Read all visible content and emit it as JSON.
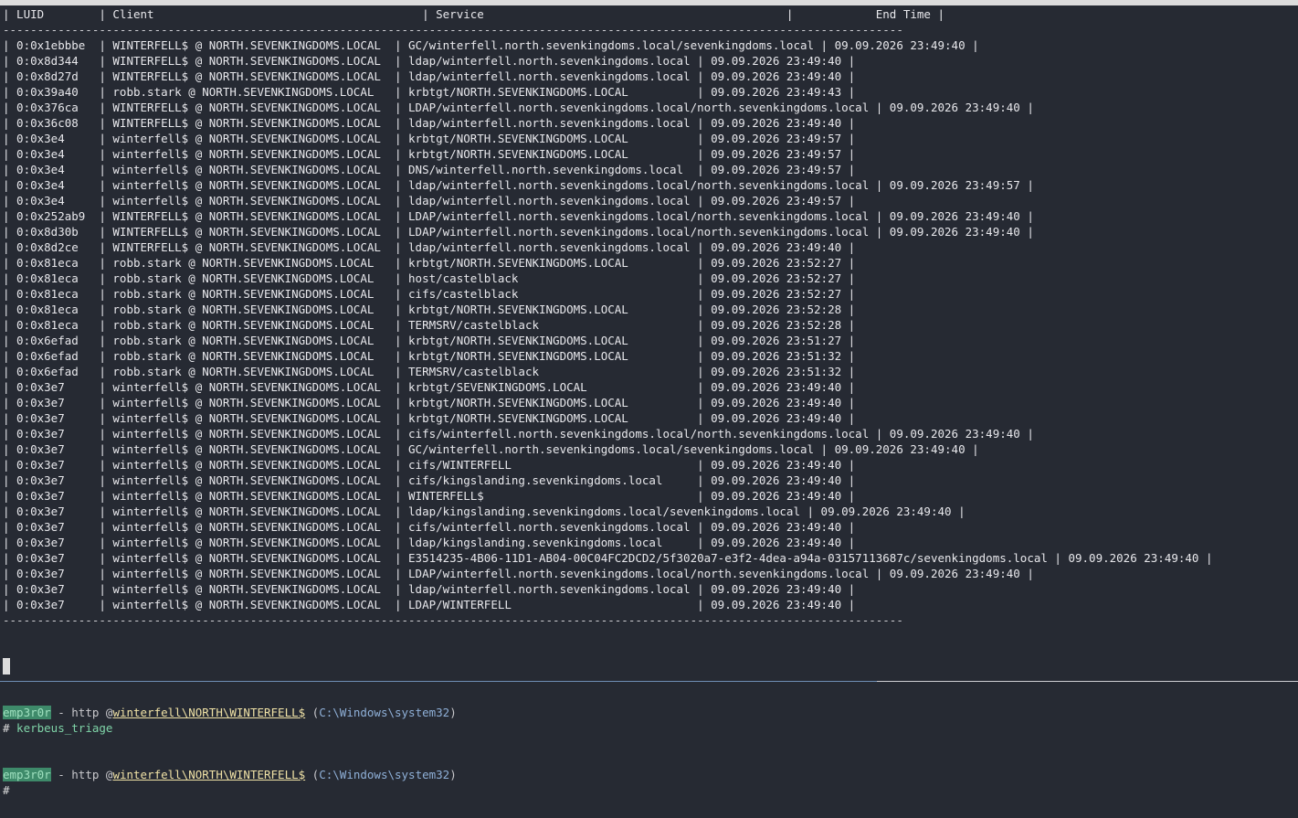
{
  "table": {
    "header": "| LUID        | Client                                       | Service                                            |            End Time |",
    "separator": "-----------------------------------------------------------------------------------------------------------------------------------",
    "rows": [
      "| 0:0x1ebbbe  | WINTERFELL$ @ NORTH.SEVENKINGDOMS.LOCAL  | GC/winterfell.north.sevenkingdoms.local/sevenkingdoms.local | 09.09.2026 23:49:40 |",
      "| 0:0x8d344   | WINTERFELL$ @ NORTH.SEVENKINGDOMS.LOCAL  | ldap/winterfell.north.sevenkingdoms.local | 09.09.2026 23:49:40 |",
      "| 0:0x8d27d   | WINTERFELL$ @ NORTH.SEVENKINGDOMS.LOCAL  | ldap/winterfell.north.sevenkingdoms.local | 09.09.2026 23:49:40 |",
      "| 0:0x39a40   | robb.stark @ NORTH.SEVENKINGDOMS.LOCAL   | krbtgt/NORTH.SEVENKINGDOMS.LOCAL          | 09.09.2026 23:49:43 |",
      "| 0:0x376ca   | WINTERFELL$ @ NORTH.SEVENKINGDOMS.LOCAL  | LDAP/winterfell.north.sevenkingdoms.local/north.sevenkingdoms.local | 09.09.2026 23:49:40 |",
      "| 0:0x36c08   | WINTERFELL$ @ NORTH.SEVENKINGDOMS.LOCAL  | ldap/winterfell.north.sevenkingdoms.local | 09.09.2026 23:49:40 |",
      "| 0:0x3e4     | winterfell$ @ NORTH.SEVENKINGDOMS.LOCAL  | krbtgt/NORTH.SEVENKINGDOMS.LOCAL          | 09.09.2026 23:49:57 |",
      "| 0:0x3e4     | winterfell$ @ NORTH.SEVENKINGDOMS.LOCAL  | krbtgt/NORTH.SEVENKINGDOMS.LOCAL          | 09.09.2026 23:49:57 |",
      "| 0:0x3e4     | winterfell$ @ NORTH.SEVENKINGDOMS.LOCAL  | DNS/winterfell.north.sevenkingdoms.local  | 09.09.2026 23:49:57 |",
      "| 0:0x3e4     | winterfell$ @ NORTH.SEVENKINGDOMS.LOCAL  | ldap/winterfell.north.sevenkingdoms.local/north.sevenkingdoms.local | 09.09.2026 23:49:57 |",
      "| 0:0x3e4     | winterfell$ @ NORTH.SEVENKINGDOMS.LOCAL  | ldap/winterfell.north.sevenkingdoms.local | 09.09.2026 23:49:57 |",
      "| 0:0x252ab9  | WINTERFELL$ @ NORTH.SEVENKINGDOMS.LOCAL  | LDAP/winterfell.north.sevenkingdoms.local/north.sevenkingdoms.local | 09.09.2026 23:49:40 |",
      "| 0:0x8d30b   | WINTERFELL$ @ NORTH.SEVENKINGDOMS.LOCAL  | LDAP/winterfell.north.sevenkingdoms.local/north.sevenkingdoms.local | 09.09.2026 23:49:40 |",
      "| 0:0x8d2ce   | WINTERFELL$ @ NORTH.SEVENKINGDOMS.LOCAL  | ldap/winterfell.north.sevenkingdoms.local | 09.09.2026 23:49:40 |",
      "| 0:0x81eca   | robb.stark @ NORTH.SEVENKINGDOMS.LOCAL   | krbtgt/NORTH.SEVENKINGDOMS.LOCAL          | 09.09.2026 23:52:27 |",
      "| 0:0x81eca   | robb.stark @ NORTH.SEVENKINGDOMS.LOCAL   | host/castelblack                          | 09.09.2026 23:52:27 |",
      "| 0:0x81eca   | robb.stark @ NORTH.SEVENKINGDOMS.LOCAL   | cifs/castelblack                          | 09.09.2026 23:52:27 |",
      "| 0:0x81eca   | robb.stark @ NORTH.SEVENKINGDOMS.LOCAL   | krbtgt/NORTH.SEVENKINGDOMS.LOCAL          | 09.09.2026 23:52:28 |",
      "| 0:0x81eca   | robb.stark @ NORTH.SEVENKINGDOMS.LOCAL   | TERMSRV/castelblack                       | 09.09.2026 23:52:28 |",
      "| 0:0x6efad   | robb.stark @ NORTH.SEVENKINGDOMS.LOCAL   | krbtgt/NORTH.SEVENKINGDOMS.LOCAL          | 09.09.2026 23:51:27 |",
      "| 0:0x6efad   | robb.stark @ NORTH.SEVENKINGDOMS.LOCAL   | krbtgt/NORTH.SEVENKINGDOMS.LOCAL          | 09.09.2026 23:51:32 |",
      "| 0:0x6efad   | robb.stark @ NORTH.SEVENKINGDOMS.LOCAL   | TERMSRV/castelblack                       | 09.09.2026 23:51:32 |",
      "| 0:0x3e7     | winterfell$ @ NORTH.SEVENKINGDOMS.LOCAL  | krbtgt/SEVENKINGDOMS.LOCAL                | 09.09.2026 23:49:40 |",
      "| 0:0x3e7     | winterfell$ @ NORTH.SEVENKINGDOMS.LOCAL  | krbtgt/NORTH.SEVENKINGDOMS.LOCAL          | 09.09.2026 23:49:40 |",
      "| 0:0x3e7     | winterfell$ @ NORTH.SEVENKINGDOMS.LOCAL  | krbtgt/NORTH.SEVENKINGDOMS.LOCAL          | 09.09.2026 23:49:40 |",
      "| 0:0x3e7     | winterfell$ @ NORTH.SEVENKINGDOMS.LOCAL  | cifs/winterfell.north.sevenkingdoms.local/north.sevenkingdoms.local | 09.09.2026 23:49:40 |",
      "| 0:0x3e7     | winterfell$ @ NORTH.SEVENKINGDOMS.LOCAL  | GC/winterfell.north.sevenkingdoms.local/sevenkingdoms.local | 09.09.2026 23:49:40 |",
      "| 0:0x3e7     | winterfell$ @ NORTH.SEVENKINGDOMS.LOCAL  | cifs/WINTERFELL                           | 09.09.2026 23:49:40 |",
      "| 0:0x3e7     | winterfell$ @ NORTH.SEVENKINGDOMS.LOCAL  | cifs/kingslanding.sevenkingdoms.local     | 09.09.2026 23:49:40 |",
      "| 0:0x3e7     | winterfell$ @ NORTH.SEVENKINGDOMS.LOCAL  | WINTERFELL$                               | 09.09.2026 23:49:40 |",
      "| 0:0x3e7     | winterfell$ @ NORTH.SEVENKINGDOMS.LOCAL  | ldap/kingslanding.sevenkingdoms.local/sevenkingdoms.local | 09.09.2026 23:49:40 |",
      "| 0:0x3e7     | winterfell$ @ NORTH.SEVENKINGDOMS.LOCAL  | cifs/winterfell.north.sevenkingdoms.local | 09.09.2026 23:49:40 |",
      "| 0:0x3e7     | winterfell$ @ NORTH.SEVENKINGDOMS.LOCAL  | ldap/kingslanding.sevenkingdoms.local     | 09.09.2026 23:49:40 |",
      "| 0:0x3e7     | winterfell$ @ NORTH.SEVENKINGDOMS.LOCAL  | E3514235-4B06-11D1-AB04-00C04FC2DCD2/5f3020a7-e3f2-4dea-a94a-03157113687c/sevenkingdoms.local | 09.09.2026 23:49:40 |",
      "| 0:0x3e7     | winterfell$ @ NORTH.SEVENKINGDOMS.LOCAL  | LDAP/winterfell.north.sevenkingdoms.local/north.sevenkingdoms.local | 09.09.2026 23:49:40 |",
      "| 0:0x3e7     | winterfell$ @ NORTH.SEVENKINGDOMS.LOCAL  | ldap/winterfell.north.sevenkingdoms.local | 09.09.2026 23:49:40 |",
      "| 0:0x3e7     | winterfell$ @ NORTH.SEVENKINGDOMS.LOCAL  | LDAP/WINTERFELL                           | 09.09.2026 23:49:40 |"
    ],
    "footer": "-----------------------------------------------------------------------------------------------------------------------------------"
  },
  "prompts": [
    {
      "user": "emp3r0r",
      "dash": " - ",
      "proto": "http",
      "at": " @",
      "host": "winterfell\\NORTH\\WINTERFELL$",
      "open_paren": " (",
      "path": "C:\\Windows\\system32",
      "close_paren": ")",
      "hash": "#",
      "command": " kerbeus_triage"
    },
    {
      "user": "emp3r0r",
      "dash": " - ",
      "proto": "http",
      "at": " @",
      "host": "winterfell\\NORTH\\WINTERFELL$",
      "open_paren": " (",
      "path": "C:\\Windows\\system32",
      "close_paren": ")",
      "hash": "#",
      "command": ""
    }
  ],
  "colors": {
    "background": "#262a33",
    "user_badge_bg": "#3e8a6a",
    "user_badge_fg": "#9fe0bf",
    "host": "#f0e2a6",
    "path": "#8fb0d8",
    "command": "#7fd4a8"
  }
}
